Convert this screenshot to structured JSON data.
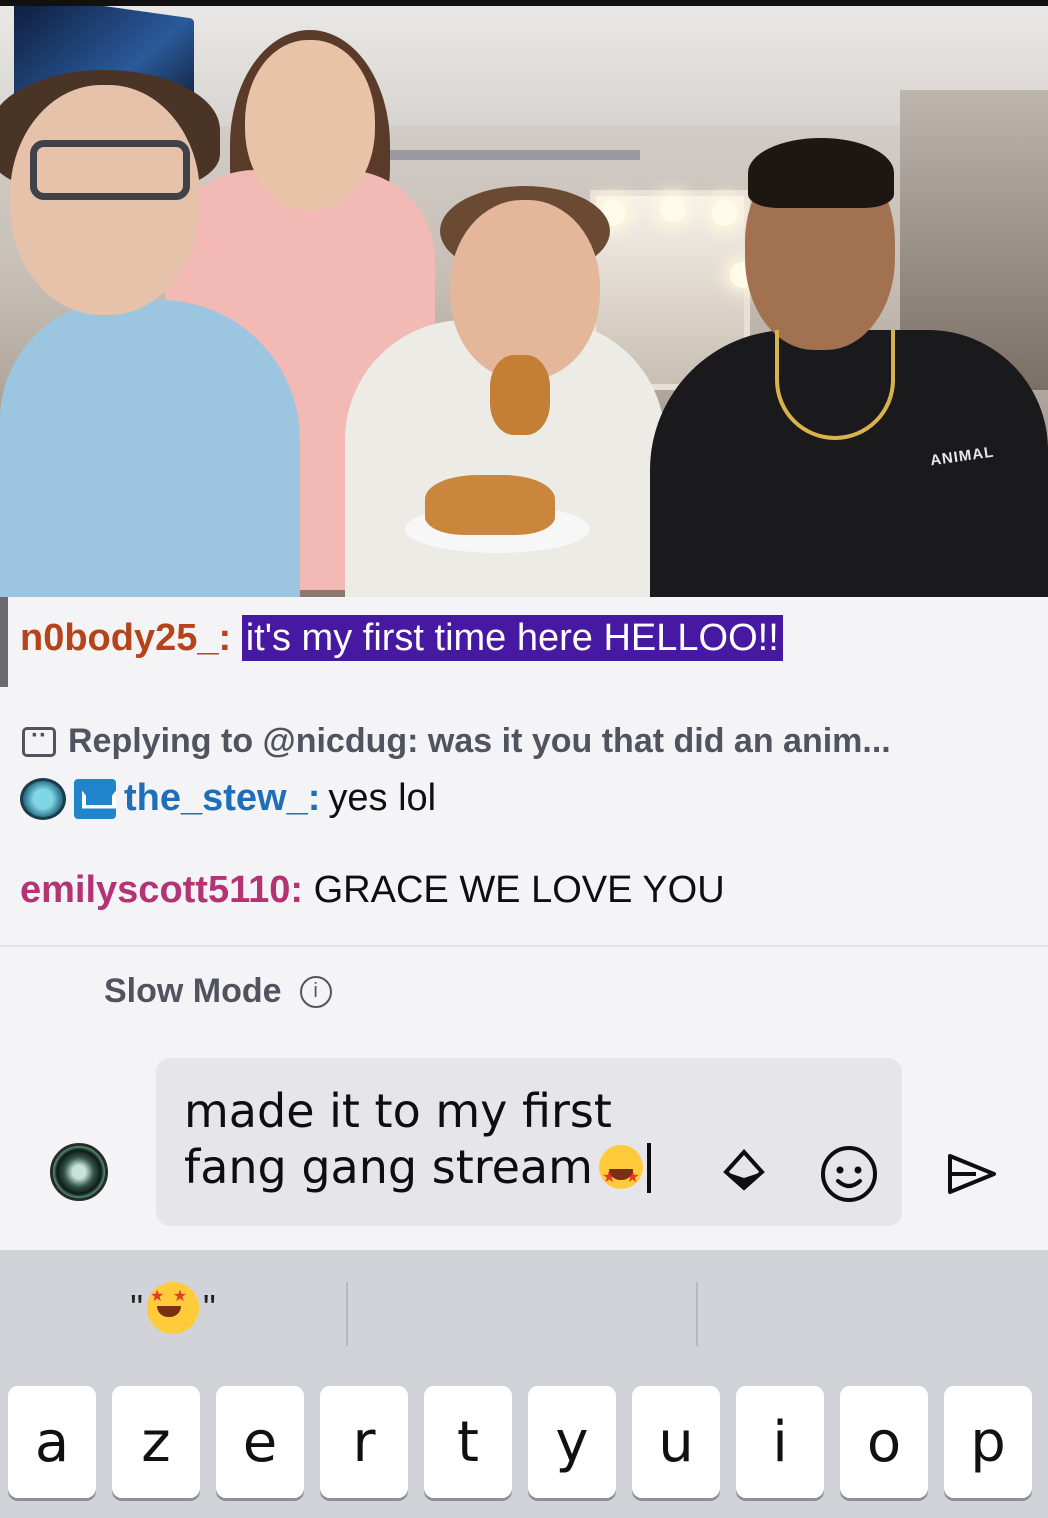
{
  "video": {
    "shirt_text": "ANIMAL"
  },
  "chat": {
    "messages": [
      {
        "user": "n0body25_:",
        "text": "it's my first time here HELLOO!!",
        "highlighted": true,
        "user_color": "#b5441a",
        "highlight_color": "#4719a3"
      },
      {
        "user": "the_stew_:",
        "text": "yes lol",
        "user_color": "#1f6fb8",
        "badges": [
          "ghost-badge-icon",
          "crown-badge-icon"
        ]
      },
      {
        "user": "emilyscott5110:",
        "text": "GRACE WE LOVE YOU",
        "user_color": "#b33474"
      }
    ],
    "reply_context": "Replying to @nicdug: was it you that did an anim..."
  },
  "slow_mode": {
    "label": "Slow Mode",
    "info_icon": "info-icon"
  },
  "composer": {
    "text_line1": "made it to my first",
    "text_line2": "fang gang stream",
    "emoji": "star-struck-emoji",
    "icons": [
      "bits-icon",
      "emote-picker-icon",
      "send-icon"
    ]
  },
  "keyboard": {
    "suggestions": [
      "\"",
      "",
      ""
    ],
    "suggestion_close_quote": "\"",
    "keys": [
      "a",
      "z",
      "e",
      "r",
      "t",
      "y",
      "u",
      "i",
      "o",
      "p"
    ]
  }
}
